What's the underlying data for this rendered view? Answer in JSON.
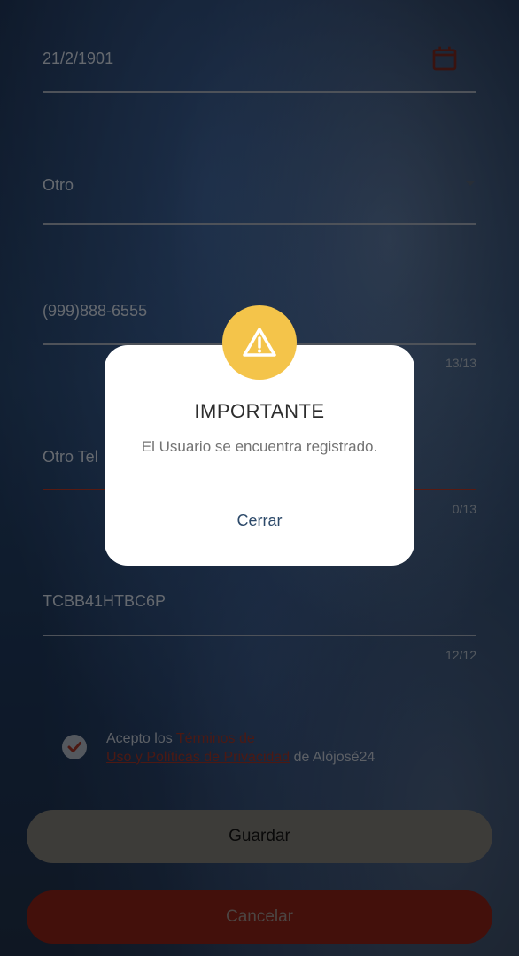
{
  "form": {
    "birthdate": "21/2/1901",
    "gender": "Otro",
    "phone": "(999)888-6555",
    "phone_counter": "13/13",
    "other_phone_placeholder": "Otro Tel",
    "other_phone_counter": "0/13",
    "rfc": "TCBB41HTBC6P",
    "rfc_counter": "12/12"
  },
  "terms": {
    "prefix": "Acepto los ",
    "link_line1": "Términos de",
    "link_line2": "Uso y Políticas de Privacidad",
    "suffix": " de Alójosé24"
  },
  "buttons": {
    "save": "Guardar",
    "cancel": "Cancelar"
  },
  "modal": {
    "title": "IMPORTANTE",
    "message": "El Usuario se encuentra registrado.",
    "close": "Cerrar"
  },
  "colors": {
    "accent": "#a1301f",
    "warning": "#f4c44a"
  }
}
